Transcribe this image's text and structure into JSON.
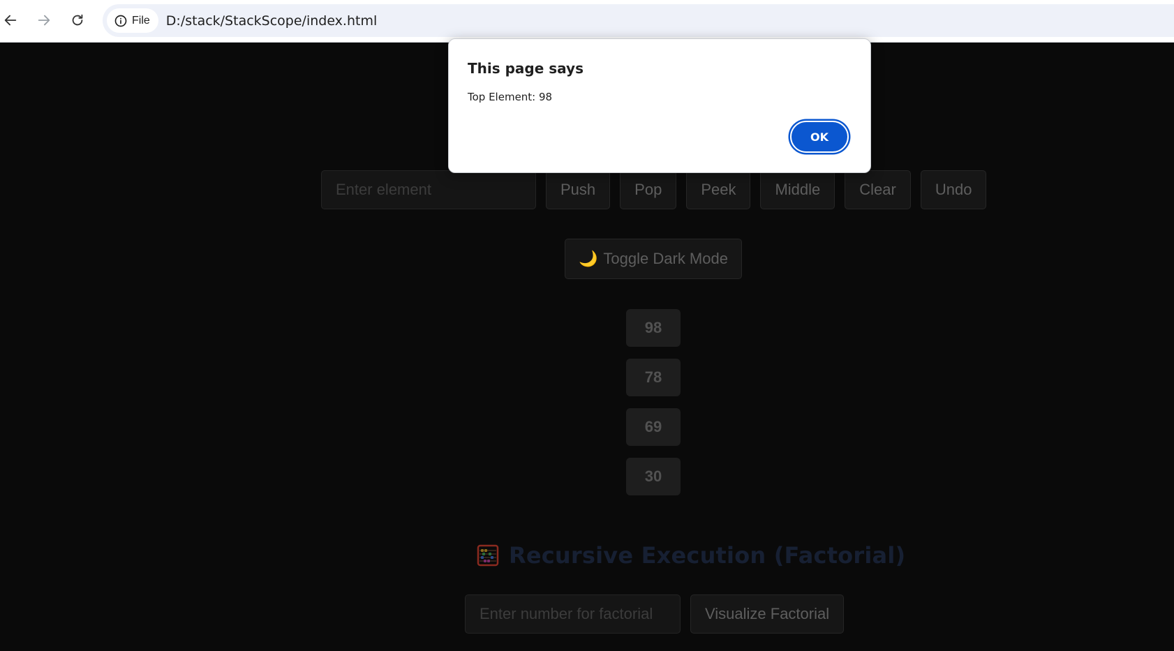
{
  "browser": {
    "site_chip_label": "File",
    "url": "D:/stack/StackScope/index.html"
  },
  "controls": {
    "input_placeholder": "Enter element",
    "push_label": "Push",
    "pop_label": "Pop",
    "peek_label": "Peek",
    "middle_label": "Middle",
    "clear_label": "Clear",
    "undo_label": "Undo",
    "toggle_icon": "🌙",
    "toggle_label": "Toggle Dark Mode"
  },
  "stack": {
    "items": [
      "98",
      "78",
      "69",
      "30"
    ]
  },
  "recursion": {
    "title": "Recursive Execution (Factorial)",
    "input_placeholder": "Enter number for factorial",
    "button_label": "Visualize Factorial"
  },
  "dialog": {
    "title": "This page says",
    "message": "Top Element: 98",
    "ok_label": "OK"
  },
  "colors": {
    "page_background": "#0a0a0a",
    "accent_blue": "#0b57d0",
    "heading_color": "#172033"
  }
}
